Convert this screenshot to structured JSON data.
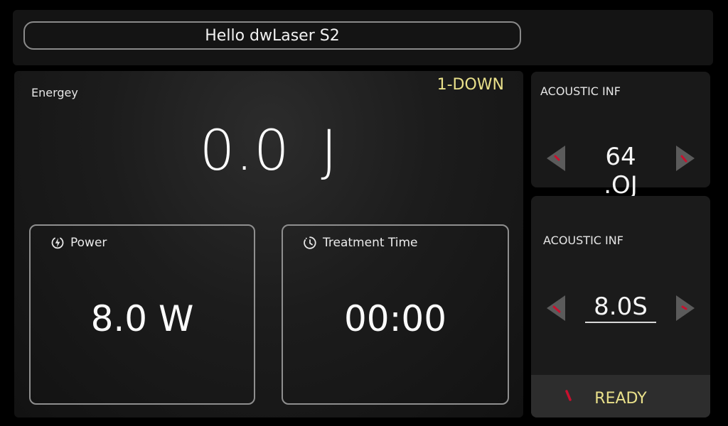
{
  "header": {
    "device_title": "Hello dwLaser S2"
  },
  "main": {
    "energy_label": "Energey",
    "mode": "1-DOWN",
    "energy_value": "0.0 J",
    "power": {
      "label": "Power",
      "icon": "power-bolt-icon",
      "value": "8.0 W"
    },
    "treatment_time": {
      "label": "Treatment Time",
      "icon": "clock-icon",
      "value": "00:00"
    }
  },
  "side": {
    "panel1": {
      "title": "ACOUSTIC INF",
      "value": "64 .OJ"
    },
    "panel2": {
      "title": "ACOUSTIC INF",
      "value": "8.0S"
    },
    "status": "READY"
  },
  "colors": {
    "accent_yellow": "#e9e08a",
    "indicator_red": "#c8102e",
    "panel_bg": "#191919",
    "border_grey": "#8f8f8f"
  }
}
